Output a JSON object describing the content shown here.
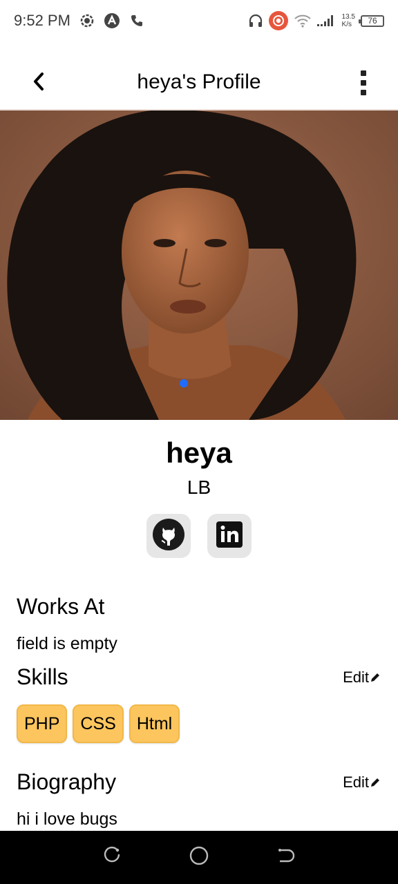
{
  "status_bar": {
    "time": "9:52 PM",
    "net_speed_value": "13.5",
    "net_speed_unit": "K/s",
    "battery": "76"
  },
  "header": {
    "title": "heya's Profile"
  },
  "profile": {
    "name": "heya",
    "location": "LB"
  },
  "socials": [
    {
      "name": "github",
      "icon": "github-icon"
    },
    {
      "name": "linkedin",
      "icon": "linkedin-icon"
    }
  ],
  "works_at": {
    "title": "Works At",
    "value": "field is empty"
  },
  "skills": {
    "title": "Skills",
    "edit_label": "Edit",
    "items": [
      "PHP",
      "CSS",
      "Html"
    ]
  },
  "biography": {
    "title": "Biography",
    "edit_label": "Edit",
    "text": "hi i love bugs"
  },
  "colors": {
    "skill_chip": "#fcc55e",
    "photo_background": "#8a5c43",
    "nav_bar": "#000000"
  }
}
